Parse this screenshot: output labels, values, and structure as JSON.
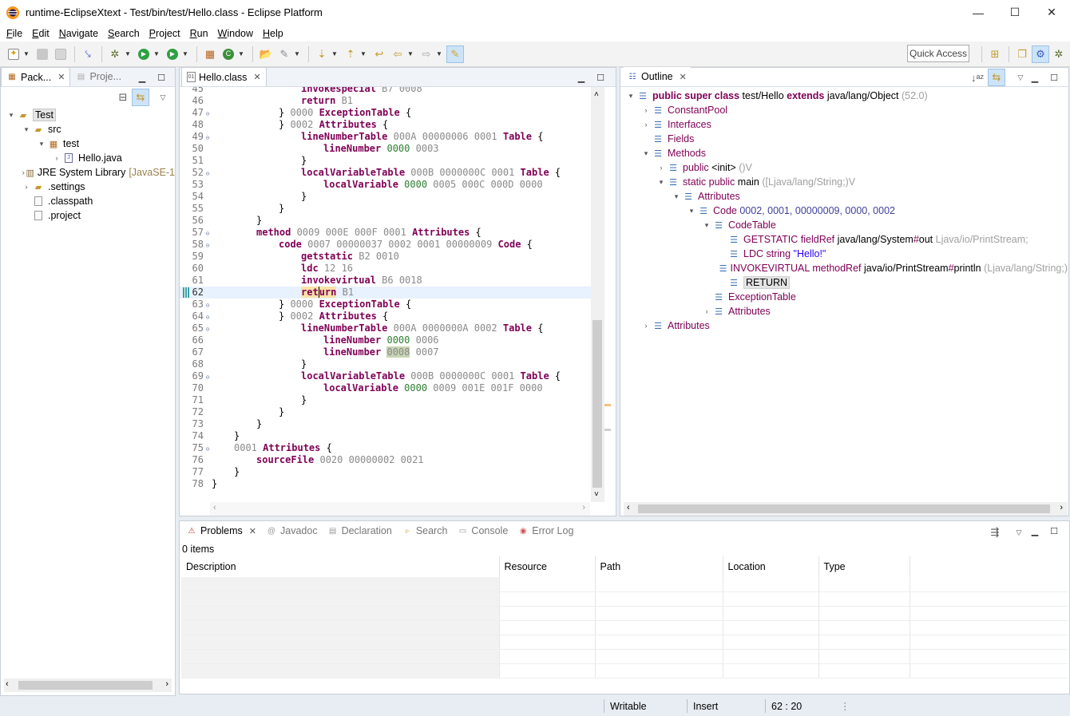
{
  "window": {
    "title": "runtime-EclipseXtext - Test/bin/test/Hello.class - Eclipse Platform",
    "minimize": "—",
    "maximize": "☐",
    "close": "✕"
  },
  "menu": [
    "File",
    "Edit",
    "Navigate",
    "Search",
    "Project",
    "Run",
    "Window",
    "Help"
  ],
  "toolbar": {
    "quick_access": "Quick Access"
  },
  "package_explorer": {
    "tabs": [
      {
        "label": "Pack...",
        "active": true
      },
      {
        "label": "Proje...",
        "active": false
      }
    ],
    "tree": [
      {
        "label": "Test",
        "depth": 0,
        "twisty": "▾",
        "icon": "project-folder-icon",
        "selected": true
      },
      {
        "label": "src",
        "depth": 1,
        "twisty": "▾",
        "icon": "source-folder-icon"
      },
      {
        "label": "test",
        "depth": 2,
        "twisty": "▾",
        "icon": "package-icon"
      },
      {
        "label": "Hello.java",
        "depth": 3,
        "twisty": "›",
        "icon": "java-file-icon"
      },
      {
        "label": "JRE System Library",
        "suffix": "[JavaSE-1",
        "depth": 1,
        "twisty": "›",
        "icon": "library-icon"
      },
      {
        "label": ".settings",
        "depth": 1,
        "twisty": "›",
        "icon": "folder-icon"
      },
      {
        "label": ".classpath",
        "depth": 1,
        "twisty": "",
        "icon": "file-icon"
      },
      {
        "label": ".project",
        "depth": 1,
        "twisty": "",
        "icon": "file-icon"
      }
    ]
  },
  "editor": {
    "tab": "Hello.class",
    "cursor_line": 62,
    "first_line_partial": "45",
    "lines": [
      {
        "n": "45",
        "indent": 4,
        "tokens": [
          [
            "kw",
            "invokespecial"
          ],
          [
            "hx",
            " B7 0008"
          ]
        ]
      },
      {
        "n": "46",
        "indent": 4,
        "tokens": [
          [
            "kw",
            "return"
          ],
          [
            "hx",
            " B1"
          ]
        ]
      },
      {
        "n": "47",
        "fold": true,
        "indent": 3,
        "tokens": [
          [
            "",
            "} "
          ],
          [
            "hx",
            "0000 "
          ],
          [
            "kw",
            "ExceptionTable"
          ],
          [
            "",
            " {"
          ]
        ]
      },
      {
        "n": "48",
        "indent": 3,
        "tokens": [
          [
            "",
            "} "
          ],
          [
            "hx",
            "0002 "
          ],
          [
            "kw",
            "Attributes"
          ],
          [
            "",
            " {"
          ]
        ]
      },
      {
        "n": "49",
        "fold": true,
        "indent": 4,
        "tokens": [
          [
            "kw",
            "lineNumberTable"
          ],
          [
            "hx",
            " 000A 00000006 0001 "
          ],
          [
            "kw",
            "Table"
          ],
          [
            "",
            " {"
          ]
        ]
      },
      {
        "n": "50",
        "indent": 5,
        "tokens": [
          [
            "kw",
            "lineNumber"
          ],
          [
            "hx",
            " "
          ],
          [
            "occg",
            "0000"
          ],
          [
            "hx",
            " 0003"
          ]
        ]
      },
      {
        "n": "51",
        "indent": 4,
        "tokens": [
          [
            "",
            "}"
          ]
        ]
      },
      {
        "n": "52",
        "fold": true,
        "indent": 4,
        "tokens": [
          [
            "kw",
            "localVariableTable"
          ],
          [
            "hx",
            " 000B 0000000C 0001 "
          ],
          [
            "kw",
            "Table"
          ],
          [
            "",
            " {"
          ]
        ]
      },
      {
        "n": "53",
        "indent": 5,
        "tokens": [
          [
            "kw",
            "localVariable"
          ],
          [
            "hx",
            " "
          ],
          [
            "occg",
            "0000"
          ],
          [
            "hx",
            " 0005 000C 000D 0000"
          ]
        ]
      },
      {
        "n": "54",
        "indent": 4,
        "tokens": [
          [
            "",
            "}"
          ]
        ]
      },
      {
        "n": "55",
        "indent": 3,
        "tokens": [
          [
            "",
            "}"
          ]
        ]
      },
      {
        "n": "56",
        "indent": 2,
        "tokens": [
          [
            "",
            "}"
          ]
        ]
      },
      {
        "n": "57",
        "fold": true,
        "indent": 2,
        "tokens": [
          [
            "kw",
            "method"
          ],
          [
            "hx",
            " 0009 000E 000F 0001 "
          ],
          [
            "kw",
            "Attributes"
          ],
          [
            "",
            " {"
          ]
        ]
      },
      {
        "n": "58",
        "fold": true,
        "indent": 3,
        "tokens": [
          [
            "kw",
            "code"
          ],
          [
            "hx",
            " 0007 00000037 0002 0001 00000009 "
          ],
          [
            "kw",
            "Code"
          ],
          [
            "",
            " {"
          ]
        ]
      },
      {
        "n": "59",
        "indent": 4,
        "tokens": [
          [
            "kw",
            "getstatic"
          ],
          [
            "hx",
            " B2 0010"
          ]
        ]
      },
      {
        "n": "60",
        "indent": 4,
        "tokens": [
          [
            "kw",
            "ldc"
          ],
          [
            "hx",
            " 12 16"
          ]
        ]
      },
      {
        "n": "61",
        "indent": 4,
        "tokens": [
          [
            "kw",
            "invokevirtual"
          ],
          [
            "hx",
            " B6 0018"
          ]
        ]
      },
      {
        "n": "62",
        "indent": 4,
        "current": true,
        "tokens": [
          [
            "kwocc",
            "ret"
          ],
          [
            "kwocccaret",
            "urn"
          ],
          [
            "hx",
            " B1"
          ]
        ]
      },
      {
        "n": "63",
        "fold": true,
        "indent": 3,
        "tokens": [
          [
            "",
            "} "
          ],
          [
            "hx",
            "0000 "
          ],
          [
            "kw",
            "ExceptionTable"
          ],
          [
            "",
            " {"
          ]
        ]
      },
      {
        "n": "64",
        "fold": true,
        "indent": 3,
        "tokens": [
          [
            "",
            "} "
          ],
          [
            "hx",
            "0002 "
          ],
          [
            "kw",
            "Attributes"
          ],
          [
            "",
            " {"
          ]
        ]
      },
      {
        "n": "65",
        "fold": true,
        "indent": 4,
        "tokens": [
          [
            "kw",
            "lineNumberTable"
          ],
          [
            "hx",
            " 000A 0000000A 0002 "
          ],
          [
            "kw",
            "Table"
          ],
          [
            "",
            " {"
          ]
        ]
      },
      {
        "n": "66",
        "indent": 5,
        "tokens": [
          [
            "kw",
            "lineNumber"
          ],
          [
            "hx",
            " "
          ],
          [
            "occg",
            "0000"
          ],
          [
            "hx",
            " 0006"
          ]
        ]
      },
      {
        "n": "67",
        "indent": 5,
        "tokens": [
          [
            "kw",
            "lineNumber"
          ],
          [
            "hx",
            " "
          ],
          [
            "occd",
            "0008"
          ],
          [
            "hx",
            " 0007"
          ]
        ]
      },
      {
        "n": "68",
        "indent": 4,
        "tokens": [
          [
            "",
            "}"
          ]
        ]
      },
      {
        "n": "69",
        "fold": true,
        "indent": 4,
        "tokens": [
          [
            "kw",
            "localVariableTable"
          ],
          [
            "hx",
            " 000B 0000000C 0001 "
          ],
          [
            "kw",
            "Table"
          ],
          [
            "",
            " {"
          ]
        ]
      },
      {
        "n": "70",
        "indent": 5,
        "tokens": [
          [
            "kw",
            "localVariable"
          ],
          [
            "hx",
            " "
          ],
          [
            "occg",
            "0000"
          ],
          [
            "hx",
            " 0009 001E 001F 0000"
          ]
        ]
      },
      {
        "n": "71",
        "indent": 4,
        "tokens": [
          [
            "",
            "}"
          ]
        ]
      },
      {
        "n": "72",
        "indent": 3,
        "tokens": [
          [
            "",
            "}"
          ]
        ]
      },
      {
        "n": "73",
        "indent": 2,
        "tokens": [
          [
            "",
            "}"
          ]
        ]
      },
      {
        "n": "74",
        "indent": 1,
        "tokens": [
          [
            "",
            "}"
          ]
        ]
      },
      {
        "n": "75",
        "fold": true,
        "indent": 1,
        "tokens": [
          [
            "hx",
            "0001 "
          ],
          [
            "kw",
            "Attributes"
          ],
          [
            "",
            " {"
          ]
        ]
      },
      {
        "n": "76",
        "indent": 2,
        "tokens": [
          [
            "kw",
            "sourceFile"
          ],
          [
            "hx",
            " 0020 00000002 0021"
          ]
        ]
      },
      {
        "n": "77",
        "indent": 1,
        "tokens": [
          [
            "",
            "}"
          ]
        ]
      },
      {
        "n": "78",
        "indent": 0,
        "tokens": [
          [
            "",
            "}"
          ]
        ]
      },
      {
        "n": "79",
        "indent": 0,
        "tokens": []
      }
    ]
  },
  "outline": {
    "tab": "Outline",
    "tree": [
      {
        "depth": 0,
        "twisty": "▾",
        "parts": [
          [
            "darkp",
            "public super class "
          ],
          [
            "",
            "test/Hello "
          ],
          [
            "darkp",
            "extends "
          ],
          [
            "",
            "java/lang/Object "
          ],
          [
            "gray",
            "(52.0)"
          ]
        ]
      },
      {
        "depth": 1,
        "twisty": "›",
        "parts": [
          [
            "purple",
            "ConstantPool"
          ]
        ]
      },
      {
        "depth": 1,
        "twisty": "›",
        "parts": [
          [
            "purple",
            "Interfaces"
          ]
        ]
      },
      {
        "depth": 1,
        "twisty": "",
        "parts": [
          [
            "purple",
            "Fields"
          ]
        ]
      },
      {
        "depth": 1,
        "twisty": "▾",
        "parts": [
          [
            "purple",
            "Methods"
          ]
        ]
      },
      {
        "depth": 2,
        "twisty": "›",
        "parts": [
          [
            "purple",
            "public "
          ],
          [
            "",
            "<init> "
          ],
          [
            "gray",
            "()V"
          ]
        ]
      },
      {
        "depth": 2,
        "twisty": "▾",
        "parts": [
          [
            "purple",
            "static public "
          ],
          [
            "",
            "main "
          ],
          [
            "gray",
            "([Ljava/lang/String;)V"
          ]
        ]
      },
      {
        "depth": 3,
        "twisty": "▾",
        "parts": [
          [
            "purple",
            "Attributes"
          ]
        ]
      },
      {
        "depth": 4,
        "twisty": "▾",
        "parts": [
          [
            "purple",
            "Code "
          ],
          [
            "navy",
            "0002, 0001, 00000009, 0000, 0002"
          ]
        ]
      },
      {
        "depth": 5,
        "twisty": "▾",
        "parts": [
          [
            "purple",
            "CodeTable"
          ]
        ]
      },
      {
        "depth": 6,
        "twisty": "",
        "parts": [
          [
            "purple",
            "GETSTATIC fieldRef "
          ],
          [
            "",
            "java/lang/System"
          ],
          [
            "purple",
            "#"
          ],
          [
            "",
            "out "
          ],
          [
            "gray",
            "Ljava/io/PrintStream;"
          ]
        ]
      },
      {
        "depth": 6,
        "twisty": "",
        "parts": [
          [
            "purple",
            "LDC string "
          ],
          [
            "blue",
            "\"Hello!\""
          ]
        ]
      },
      {
        "depth": 6,
        "twisty": "",
        "parts": [
          [
            "purple",
            "INVOKEVIRTUAL methodRef "
          ],
          [
            "",
            "java/io/PrintStream"
          ],
          [
            "purple",
            "#"
          ],
          [
            "",
            "println "
          ],
          [
            "gray",
            "(Ljava/lang/String;)"
          ]
        ]
      },
      {
        "depth": 6,
        "twisty": "",
        "selected": true,
        "parts": [
          [
            "",
            "RETURN"
          ]
        ]
      },
      {
        "depth": 5,
        "twisty": "",
        "parts": [
          [
            "purple",
            "ExceptionTable"
          ]
        ]
      },
      {
        "depth": 5,
        "twisty": "›",
        "parts": [
          [
            "purple",
            "Attributes"
          ]
        ]
      },
      {
        "depth": 1,
        "twisty": "›",
        "parts": [
          [
            "purple",
            "Attributes"
          ]
        ]
      }
    ]
  },
  "bottom": {
    "tabs": [
      {
        "label": "Problems",
        "active": true,
        "icon": "problems-icon",
        "glyph": "⚠"
      },
      {
        "label": "Javadoc",
        "active": false,
        "icon": "javadoc-icon",
        "glyph": "@"
      },
      {
        "label": "Declaration",
        "active": false,
        "icon": "declaration-icon",
        "glyph": "▤"
      },
      {
        "label": "Search",
        "active": false,
        "icon": "search-icon",
        "glyph": "⌕"
      },
      {
        "label": "Console",
        "active": false,
        "icon": "console-icon",
        "glyph": "▭"
      },
      {
        "label": "Error Log",
        "active": false,
        "icon": "error-log-icon",
        "glyph": "◉"
      }
    ],
    "count": "0 items",
    "columns": [
      "Description",
      "Resource",
      "Path",
      "Location",
      "Type"
    ]
  },
  "status": {
    "writable": "Writable",
    "insert": "Insert",
    "position": "62 : 20"
  }
}
